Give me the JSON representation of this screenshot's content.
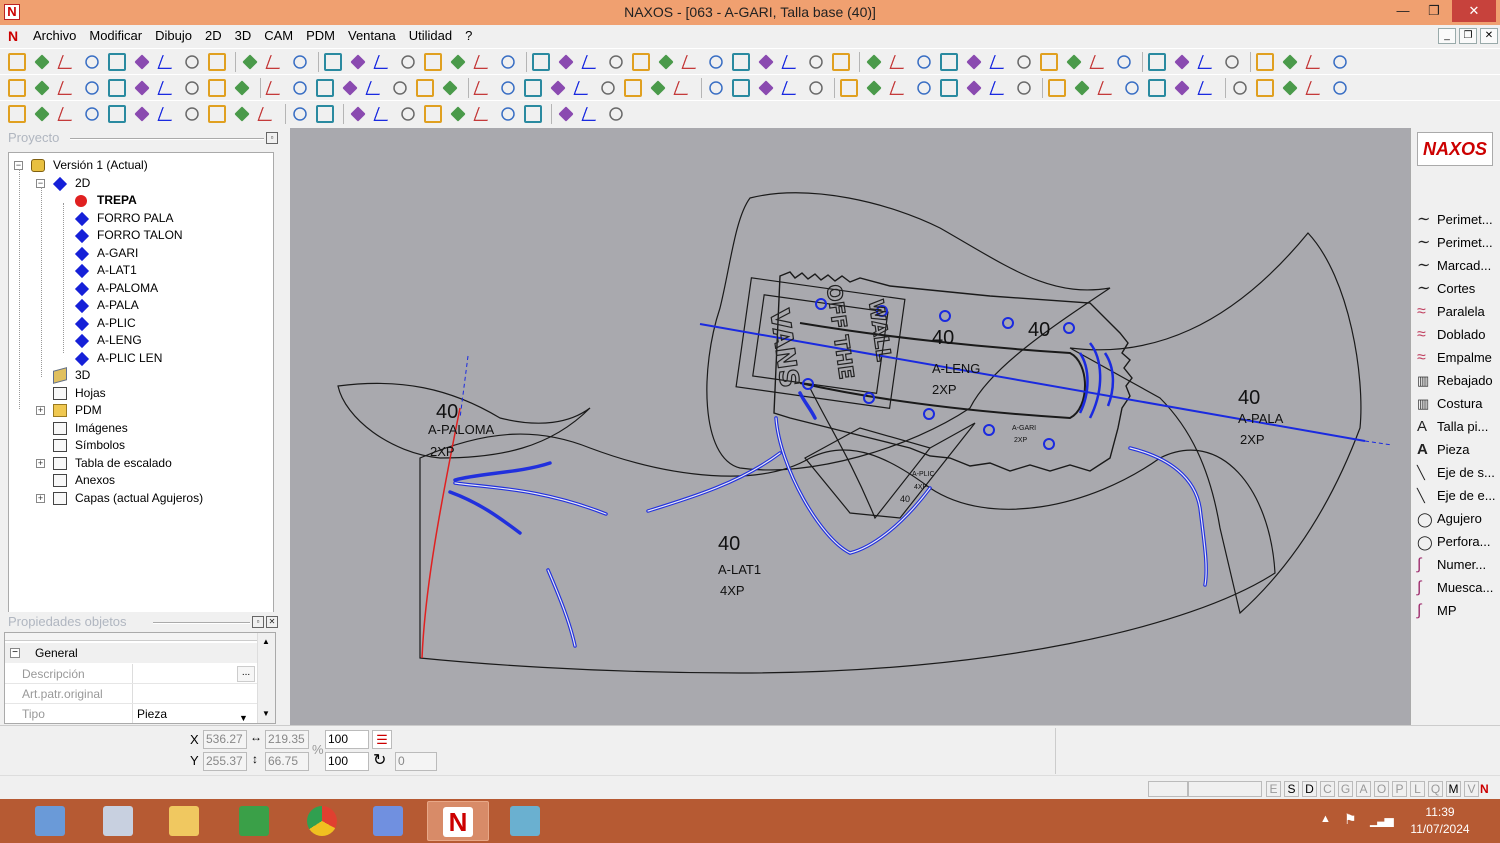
{
  "window": {
    "app_letter": "N",
    "title": "NAXOS - [063 - A-GARI, Talla base (40)]",
    "minimize": "—",
    "maximize": "❐",
    "close": "✕"
  },
  "menu": {
    "items": [
      "Archivo",
      "Modificar",
      "Dibujo",
      "2D",
      "3D",
      "CAM",
      "PDM",
      "Ventana",
      "Utilidad",
      "?"
    ]
  },
  "project_panel": {
    "title": "Proyecto",
    "tree": [
      {
        "label": "Versión 1 (Actual)",
        "icon": "version-icon",
        "bold": false
      },
      {
        "label": "2D",
        "icon": "diamond-folder-icon",
        "bold": false
      },
      {
        "label": "TREPA",
        "icon": "red-dot-icon",
        "bold": true
      },
      {
        "label": "FORRO PALA",
        "icon": "diamond-icon",
        "bold": false
      },
      {
        "label": "FORRO TALON",
        "icon": "diamond-icon",
        "bold": false
      },
      {
        "label": "A-GARI",
        "icon": "diamond-icon",
        "bold": false
      },
      {
        "label": "A-LAT1",
        "icon": "diamond-icon",
        "bold": false
      },
      {
        "label": "A-PALOMA",
        "icon": "diamond-icon",
        "bold": false
      },
      {
        "label": "A-PALA",
        "icon": "diamond-icon",
        "bold": false
      },
      {
        "label": "A-PLIC",
        "icon": "diamond-icon",
        "bold": false
      },
      {
        "label": "A-LENG",
        "icon": "diamond-icon",
        "bold": false
      },
      {
        "label": "A-PLIC LEN",
        "icon": "diamond-icon",
        "bold": false
      },
      {
        "label": "3D",
        "icon": "cube-icon",
        "bold": false
      },
      {
        "label": "Hojas",
        "icon": "sheets-icon",
        "bold": false
      },
      {
        "label": "PDM",
        "icon": "folder-icon",
        "bold": false
      },
      {
        "label": "Imágenes",
        "icon": "images-icon",
        "bold": false
      },
      {
        "label": "Símbolos",
        "icon": "symbols-icon",
        "bold": false
      },
      {
        "label": "Tabla de escalado",
        "icon": "table-icon",
        "bold": false
      },
      {
        "label": "Anexos",
        "icon": "attachment-icon",
        "bold": false
      },
      {
        "label": "Capas (actual Agujeros)",
        "icon": "layers-icon",
        "bold": false
      }
    ]
  },
  "properties_panel": {
    "title": "Propiedades objetos",
    "group": "General",
    "rows": [
      {
        "key": "Descripción",
        "value": "",
        "button": "..."
      },
      {
        "key": "Art.patr.original",
        "value": ""
      },
      {
        "key": "Tipo",
        "value": "Pieza"
      }
    ]
  },
  "canvas": {
    "pieces": [
      {
        "size": "40",
        "name": "A-PALOMA",
        "qty": "2XP"
      },
      {
        "size": "40",
        "name": "A-LENG",
        "qty": "2XP"
      },
      {
        "size": "40",
        "name": "",
        "qty": ""
      },
      {
        "size": "40",
        "name": "A-PALA",
        "qty": "2XP"
      },
      {
        "size": "40",
        "name": "A-LAT1",
        "qty": "4XP"
      }
    ],
    "small_labels": {
      "gari": "A-GARI",
      "gari_qty": "2XP",
      "plic": "A-PLIC",
      "plic_qty": "4XP",
      "plic_size": "40"
    },
    "logo_text": {
      "brand": "VANS",
      "line1": "OFF THE",
      "line2": "WALL"
    }
  },
  "palette": {
    "logo": "NAXOS",
    "items": [
      {
        "label": "Perimet...",
        "icon": "perimeter-curve-icon"
      },
      {
        "label": "Perimet...",
        "icon": "perimeter-curve-icon"
      },
      {
        "label": "Marcad...",
        "icon": "marking-curve-icon"
      },
      {
        "label": "Cortes",
        "icon": "cut-curve-icon"
      },
      {
        "label": "Paralela",
        "icon": "parallel-icon"
      },
      {
        "label": "Doblado",
        "icon": "fold-icon"
      },
      {
        "label": "Empalme",
        "icon": "splice-icon"
      },
      {
        "label": "Rebajado",
        "icon": "skive-icon"
      },
      {
        "label": "Costura",
        "icon": "seam-icon"
      },
      {
        "label": "Talla pi...",
        "icon": "text-a-icon"
      },
      {
        "label": "Pieza",
        "icon": "text-a-bold-icon"
      },
      {
        "label": "Eje de s...",
        "icon": "axis-icon"
      },
      {
        "label": "Eje de e...",
        "icon": "axis-icon"
      },
      {
        "label": "Agujero",
        "icon": "hole-circle-icon"
      },
      {
        "label": "Perfora...",
        "icon": "perforation-circle-icon"
      },
      {
        "label": "Numer...",
        "icon": "number-icon"
      },
      {
        "label": "Muesca...",
        "icon": "notch-icon"
      },
      {
        "label": "MP",
        "icon": "mp-icon"
      }
    ]
  },
  "coords": {
    "x_label": "X",
    "y_label": "Y",
    "x": "536.27",
    "y": "255.37",
    "width": "219.35",
    "height": "66.75",
    "scale_x": "100",
    "scale_y": "100",
    "rotation": "0",
    "percent": "%"
  },
  "status": {
    "letters": [
      "E",
      "S",
      "D",
      "C",
      "G",
      "A",
      "O",
      "P",
      "L",
      "Q",
      "M",
      "V"
    ],
    "active_letters": [
      "S",
      "D",
      "M"
    ]
  },
  "taskbar": {
    "apps": [
      "calculator-icon",
      "file-manager-icon",
      "folder-icon",
      "app-green-icon",
      "chrome-icon",
      "document-icon",
      "naxos-icon",
      "eraser-icon"
    ],
    "time": "11:39",
    "date": "11/07/2024"
  },
  "colors": {
    "titlebar": "#f0a070",
    "canvas": "#a9a9ae",
    "taskbar": "#b65a33",
    "blue_axis": "#1a2ae0",
    "red_line": "#e02020"
  }
}
